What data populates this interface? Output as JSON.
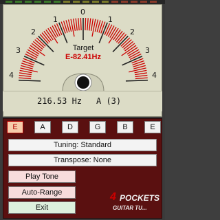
{
  "meter": {
    "scale_left": [
      "4",
      "3",
      "2",
      "1"
    ],
    "center": "0",
    "scale_right": [
      "1",
      "2",
      "3",
      "4"
    ],
    "target_label": "Target",
    "target_note": "E-82.41Hz"
  },
  "readout": {
    "frequency": "216.53 Hz",
    "note": "A (3)"
  },
  "strings": [
    "E",
    "A",
    "D",
    "G",
    "B",
    "E"
  ],
  "selected_string_index": 0,
  "tuning": {
    "label": "Tuning: Standard"
  },
  "transpose": {
    "label": "Transpose: None"
  },
  "buttons": {
    "play_tone": "Play Tone",
    "auto_range": "Auto-Range",
    "exit": "Exit"
  },
  "logo": {
    "number": "4",
    "word": "POCKETS",
    "tagline": "GUITAR TU..."
  },
  "colors": {
    "needle_red": "#cc0000",
    "panel_maroon": "#5a1010",
    "meter_face": "#dcdcc6"
  }
}
